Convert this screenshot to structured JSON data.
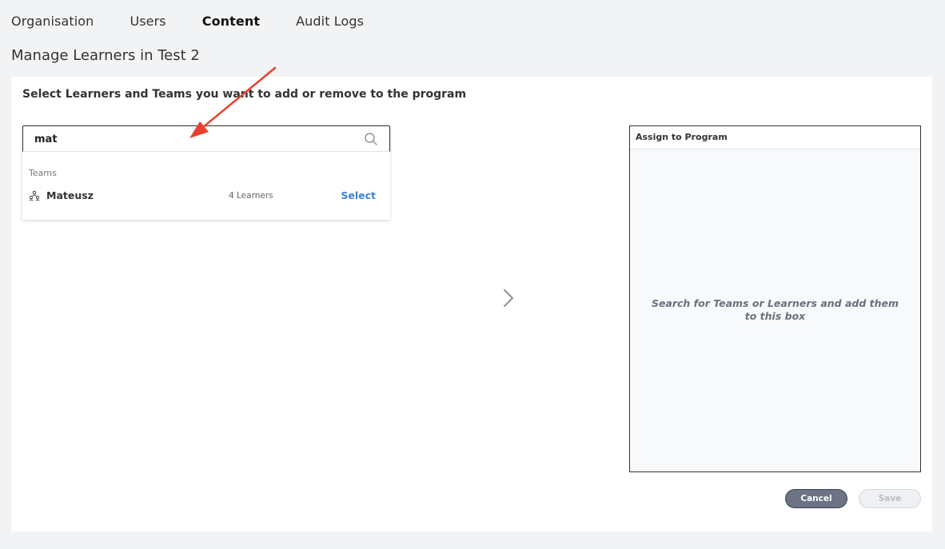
{
  "nav": {
    "tabs": [
      {
        "label": "Organisation"
      },
      {
        "label": "Users"
      },
      {
        "label": "Content"
      },
      {
        "label": "Audit Logs"
      }
    ],
    "active": "Content"
  },
  "page": {
    "title": "Manage Learners in Test 2"
  },
  "card": {
    "heading": "Select Learners and Teams you want to add or remove to the program"
  },
  "search": {
    "value": "mat",
    "group_label": "Teams",
    "results": [
      {
        "name": "Mateusz",
        "count": "4 Learners",
        "action": "Select"
      }
    ]
  },
  "assign": {
    "title": "Assign to Program",
    "empty_text": "Search for Teams or Learners and add them to this box"
  },
  "buttons": {
    "cancel": "Cancel",
    "save": "Save"
  },
  "colors": {
    "accent": "#3b82d6",
    "annotation": "#e8402e",
    "cancel_bg": "#6b7385"
  }
}
